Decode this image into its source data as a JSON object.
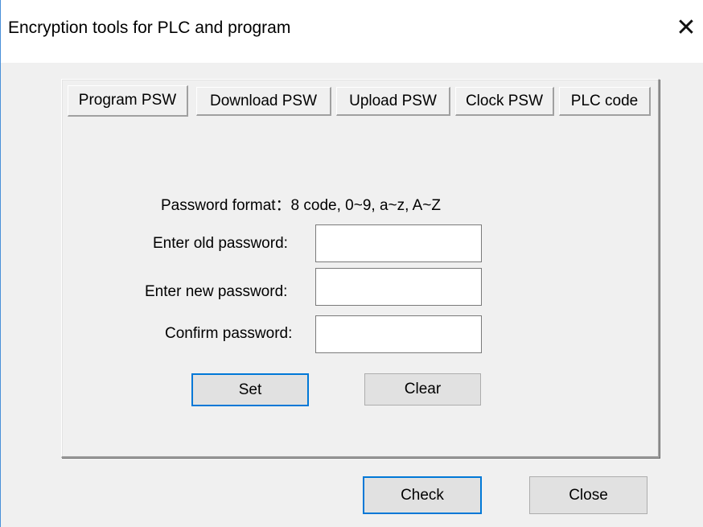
{
  "window": {
    "title": "Encryption tools for PLC and program",
    "close_glyph": "✕"
  },
  "tabs": [
    {
      "label": "Program PSW",
      "active": true
    },
    {
      "label": "Download PSW",
      "active": false
    },
    {
      "label": "Upload PSW",
      "active": false
    },
    {
      "label": "Clock PSW",
      "active": false
    },
    {
      "label": "PLC code",
      "active": false
    }
  ],
  "form": {
    "format_text": "Password format：8 code, 0~9, a~z, A~Z",
    "old_label": "Enter old password:",
    "old_value": "",
    "new_label": "Enter new password:",
    "new_value": "",
    "confirm_label": "Confirm password:",
    "confirm_value": "",
    "set_label": "Set",
    "clear_label": "Clear"
  },
  "footer": {
    "check_label": "Check",
    "close_label": "Close"
  },
  "colors": {
    "window_bg": "#f0f0f0",
    "title_bg": "#ffffff",
    "accent": "#0078d7",
    "button_bg": "#e1e1e1"
  },
  "icons": {
    "close": "close-icon"
  }
}
